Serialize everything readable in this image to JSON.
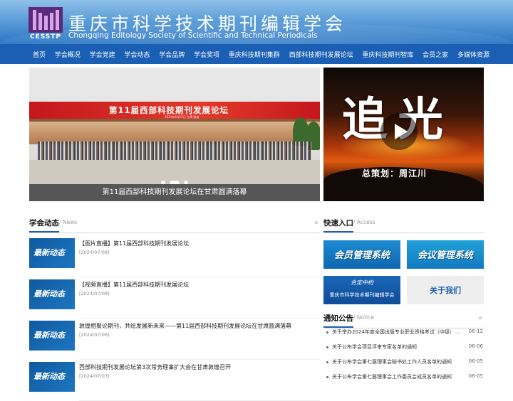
{
  "header": {
    "logo_text": "CESSTP",
    "title": "重庆市科学技术期刊编辑学会",
    "subtitle": "Chongqing Editology Society of Scientific and Technical Periodicals"
  },
  "nav": {
    "items": [
      "首页",
      "学会概况",
      "学会党建",
      "学会动态",
      "学会品牌",
      "学会奖项",
      "重庆科技期刊集群",
      "西部科技期刊发展论坛",
      "重庆科技期刊智库",
      "会员之家",
      "多媒体资源"
    ]
  },
  "slider": {
    "banner_title": "第11届西部科技期刊发展论坛",
    "banner_sub": "2024年6月25日 甘肃·敦煌",
    "caption": "第11届西部科技期刊发展论坛在甘肃圆满落幕",
    "slide_count": 3,
    "active_slide": 2
  },
  "video": {
    "title": "追光",
    "credit": "总策划：周江川"
  },
  "news": {
    "heading": "学会动态",
    "heading_sub": "/ News",
    "more_icon": "double-chevron-right-icon",
    "thumb_label": "最新动态",
    "items": [
      {
        "title": "【图片直播】第11届西部科技期刊发展论坛",
        "date": "[2024/07/08]"
      },
      {
        "title": "【视频直播】第11届西部科技期刊发展论坛",
        "date": "[2024/07/08]"
      },
      {
        "title": "敦煌相聚论期刊，共绘发展新未来——第11届西部科技期刊发展论坛在甘肃圆满落幕",
        "date": "[2024/07/06]"
      },
      {
        "title": "西部科技期刊发展论坛第3次常务理事扩大会在甘肃敦煌召开",
        "date": "[2024/07/03]"
      }
    ]
  },
  "quick": {
    "heading": "快速入口",
    "heading_sub": "/ Access",
    "member": "会员管理系统",
    "meeting": "会议管理系统",
    "society_top": "合定中約",
    "society_bottom": "重庆市科学技术期刊编辑学会",
    "about": "关于我们"
  },
  "notice": {
    "heading": "通知公告",
    "heading_sub": "/ Notice",
    "more_icon": "double-chevron-right-icon",
    "items": [
      {
        "title": "关于举办2024年度全国出版专业职业资格考试（中级）...",
        "date": "06-12"
      },
      {
        "title": "关于公布学会项目评审专家名单的通知",
        "date": "06-06"
      },
      {
        "title": "关于公布学会第七届理事会秘书处工作人员名单的通知",
        "date": "06-05"
      },
      {
        "title": "关于公布学会第七届理事会工作委员会成员名单的通知",
        "date": "06-05"
      }
    ]
  },
  "colors": {
    "nav_bg": "#1a5fb4",
    "accent": "#1a5fb4",
    "banner_red": "#c4161c"
  }
}
